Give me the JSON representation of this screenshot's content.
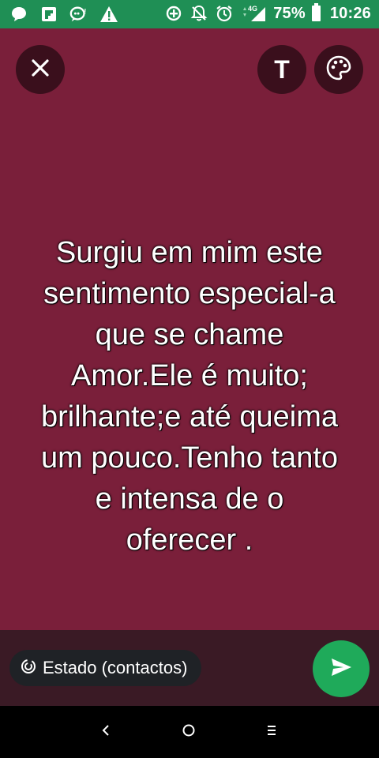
{
  "status_bar": {
    "battery_percent": "75%",
    "time": "10:26",
    "network": "4G",
    "icons": [
      "chat-bubble-icon",
      "flipboard-icon",
      "messenger-icon",
      "warning-icon",
      "data-saver-icon",
      "mute-icon",
      "alarm-icon",
      "signal-icon",
      "battery-icon"
    ]
  },
  "toolbar": {
    "close_icon": "close-icon",
    "text_button_label": "T",
    "palette_icon": "palette-icon"
  },
  "status": {
    "text": "Surgiu em mim este\nsentimento especial-a\nque se chame\nAmor.Ele é muito;\nbrilhante;e até queima\num pouco.Tenho tanto\ne intensa  de o\noferecer .",
    "background_color": "#7a1f3a"
  },
  "bottom_bar": {
    "audience_label": "Estado (contactos)",
    "audience_icon": "privacy-ring-icon",
    "send_icon": "send-icon",
    "send_color": "#1faa5a"
  },
  "nav_bar": {
    "back_icon": "back-icon",
    "home_icon": "home-icon",
    "recents_icon": "recents-icon"
  },
  "colors": {
    "status_bar": "#1f8f55",
    "canvas": "#7a1f3a",
    "bottom_bar": "#3a1a25"
  }
}
